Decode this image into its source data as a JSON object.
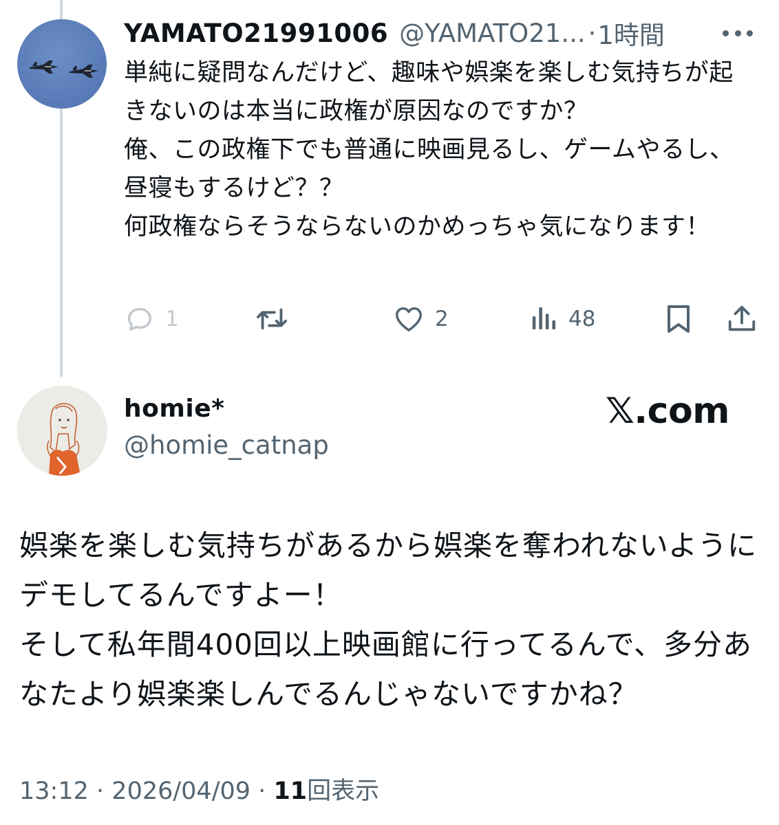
{
  "reply": {
    "display_name": "YAMATO21991006",
    "handle": "@YAMATO21...",
    "separator": "·",
    "time": "1時間",
    "body_lines": [
      "単純に疑問なんだけど、趣味や娯楽を楽しむ気持ちが起きないのは本当に政権が原因なのですか？",
      "俺、この政権下でも普通に映画見るし、ゲームやるし、昼寝もするけど？？",
      "何政権ならそうならないのかめっちゃ気になります！"
    ],
    "actions": {
      "reply_count": "1",
      "repost_count": "",
      "like_count": "2",
      "views_count": "48"
    }
  },
  "tweet": {
    "display_name": "homie*",
    "handle": "@homie_catnap",
    "watermark": "𝕏.com",
    "body_lines": [
      "娯楽を楽しむ気持ちがあるから娯楽を奪われないようにデモしてるんですよー！",
      "そして私年間400回以上映画館に行ってるんで、多分あなたより娯楽楽しんでるんじゃないですかね？"
    ],
    "time": "13:12",
    "separator1": "·",
    "date": "2026/04/09",
    "separator2": "·",
    "views": "11",
    "views_label": "回表示"
  },
  "colors": {
    "text": "#0f1419",
    "secondary": "#536471",
    "thread_line": "#cfd9de",
    "avatar_sky": "#5a7db9",
    "avatar_accent": "#e0642c"
  },
  "icons": {
    "reply": "reply-icon",
    "repost": "repost-icon",
    "like": "heart-icon",
    "views": "bar-chart-icon",
    "bookmark": "bookmark-icon",
    "share": "share-icon",
    "more": "more-icon"
  }
}
